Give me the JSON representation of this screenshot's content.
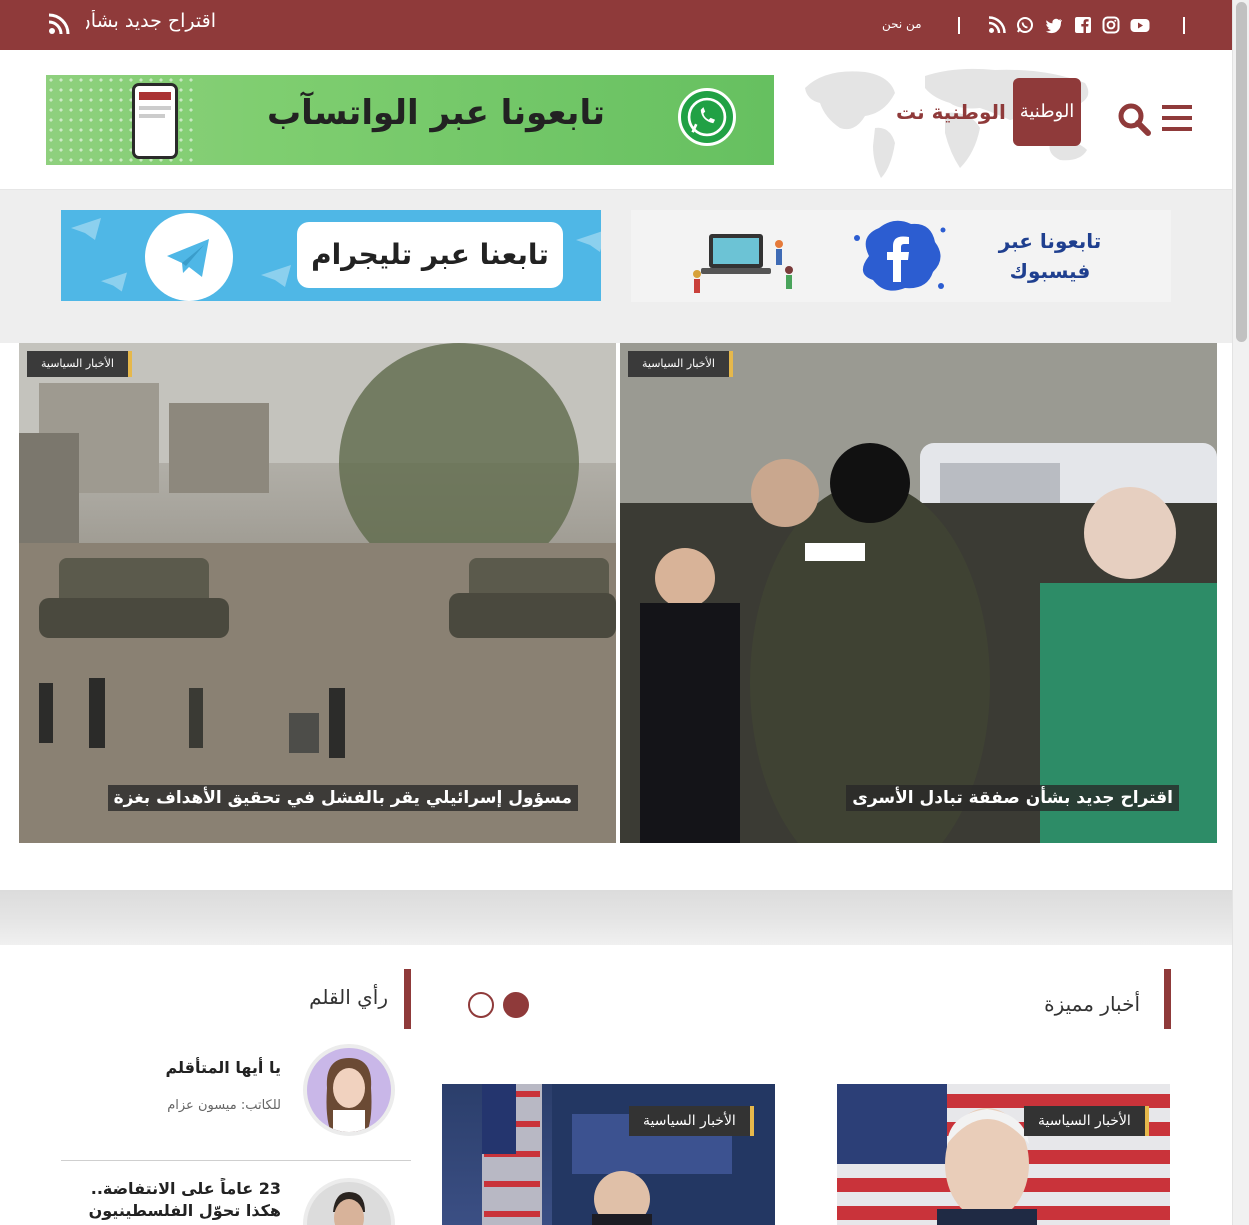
{
  "topbar": {
    "ticker_text": "اقتراح جديد بشأن صفقة تبادل الأسرى",
    "about_label": "من نحن",
    "social_icons": [
      "youtube-icon",
      "instagram-icon",
      "facebook-icon",
      "twitter-icon",
      "whatsapp-icon",
      "rss-icon"
    ],
    "bg_color": "#8f3a3a"
  },
  "header": {
    "site_name": "الوطنية نت",
    "logo_text": "الوطنية",
    "whatsapp_banner_text": "تابعونا عبر الواتسآب"
  },
  "banners": {
    "telegram_text": "تابعنا عبر تليجرام",
    "facebook_text_line1": "تابعونا عبر",
    "facebook_text_line2": "فيسبوك"
  },
  "hero": [
    {
      "category": "الأخبار السياسية",
      "headline": "مسؤول إسرائيلي يقر بالفشل في تحقيق الأهداف بغزة"
    },
    {
      "category": "الأخبار السياسية",
      "headline": "اقتراح جديد بشأن صفقة تبادل الأسرى"
    }
  ],
  "opinion_section": {
    "title": "رأي القلم",
    "items": [
      {
        "title": "يا أيها المتأقلم",
        "author": "للكاتب: ميسون عزام"
      },
      {
        "title": "23 عاماً على الانتفاضة.. هكذا تحوّل الفلسطينيون"
      }
    ]
  },
  "featured_section": {
    "title": "أخبار مميزة",
    "slider_dots": 2,
    "active_dot": 1,
    "items": [
      {
        "category": "الأخبار السياسية"
      },
      {
        "category": "الأخبار السياسية"
      }
    ]
  },
  "colors": {
    "brand": "#8f3a3a",
    "accent": "#e6b84b"
  }
}
